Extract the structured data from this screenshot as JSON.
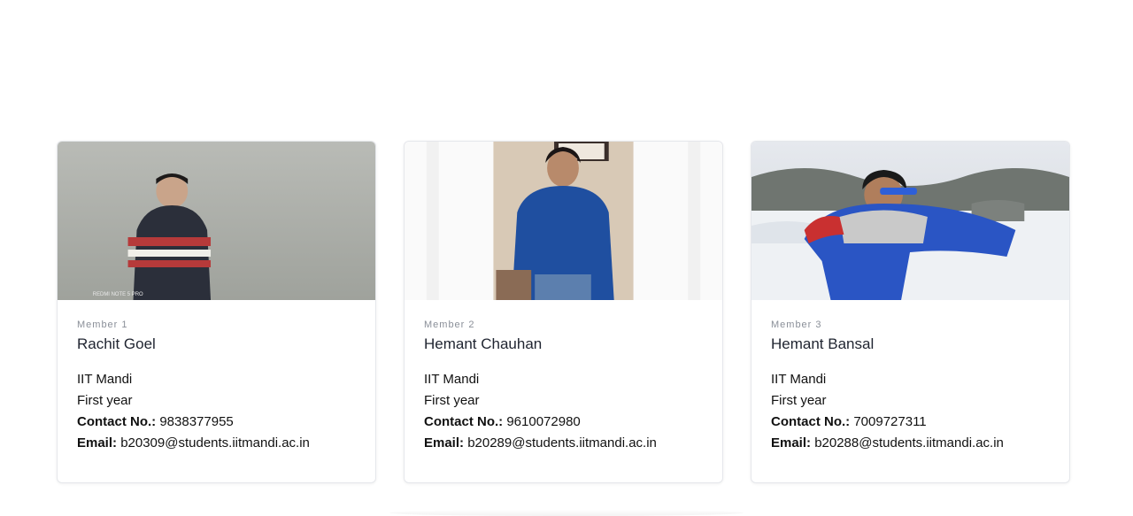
{
  "members": [
    {
      "tag": "Member 1",
      "name": "Rachit Goel",
      "institute": "IIT Mandi",
      "year": "First year",
      "contact_label": "Contact No.:",
      "contact": "9838377955",
      "email_label": "Email:",
      "email": "b20309@students.iitmandi.ac.in",
      "photo_watermark": "REDMI NOTE 5 PRO"
    },
    {
      "tag": "Member 2",
      "name": "Hemant Chauhan",
      "institute": "IIT Mandi",
      "year": "First year",
      "contact_label": "Contact No.:",
      "contact": "9610072980",
      "email_label": "Email:",
      "email": "b20289@students.iitmandi.ac.in"
    },
    {
      "tag": "Member 3",
      "name": "Hemant Bansal",
      "institute": "IIT Mandi",
      "year": "First year",
      "contact_label": "Contact No.:",
      "contact": "7009727311",
      "email_label": "Email:",
      "email": "b20288@students.iitmandi.ac.in"
    }
  ]
}
